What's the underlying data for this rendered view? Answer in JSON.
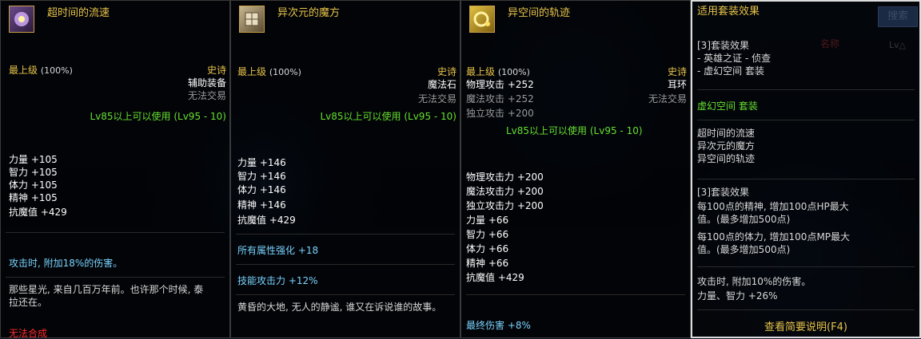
{
  "items": [
    {
      "name": "超时间的流速",
      "grade": "最上级",
      "grade_pct": "(100%)",
      "rarity": "史诗",
      "type": "辅助装备",
      "trade": "无法交易",
      "level_req": "Lv85以上可以使用 (Lv95 - 10)",
      "stats": [
        "力量 +105",
        "智力 +105",
        "体力 +105",
        "精神 +105",
        "抗魔值 +429"
      ],
      "special": "攻击时, 附加18%的伤害。",
      "flavor": "那些星光, 来自几百万年前。也许那个时候, 泰拉还在。",
      "footer": "无法合成"
    },
    {
      "name": "异次元的魔方",
      "grade": "最上级",
      "grade_pct": "(100%)",
      "rarity": "史诗",
      "type": "魔法石",
      "trade": "无法交易",
      "level_req": "Lv85以上可以使用 (Lv95 - 10)",
      "stats": [
        "力量 +146",
        "智力 +146",
        "体力 +146",
        "精神 +146",
        "抗魔值 +429"
      ],
      "bonus1": "所有属性强化 +18",
      "bonus2": "技能攻击力 +12%",
      "flavor": "黄昏的大地, 无人的静谧, 谁又在诉说谁的故事。"
    },
    {
      "name": "异空间的轨迹",
      "grade": "最上级",
      "grade_pct": "(100%)",
      "rarity": "史诗",
      "type": "耳环",
      "trade": "无法交易",
      "attacks": [
        "物理攻击 +252",
        "魔法攻击 +252",
        "独立攻击 +200"
      ],
      "level_req": "Lv85以上可以使用 (Lv95 - 10)",
      "stats": [
        "物理攻击力 +200",
        "魔法攻击力 +200",
        "独立攻击力 +200",
        "力量 +66",
        "智力 +66",
        "体力 +66",
        "精神 +66",
        "抗魔值 +429"
      ],
      "bonus": "最终伤害 +8%"
    }
  ],
  "set_panel": {
    "title": "适用套装效果",
    "search_label": "搜索",
    "effect3_header": "[3]套装效果",
    "effect3_lines": [
      "- 英雄之证 - 侦查",
      "- 虚幻空间  套装"
    ],
    "set_name": "虚幻空间  套装",
    "set_items": [
      "超时间的流速",
      "异次元的魔方",
      "异空间的轨迹"
    ],
    "effect_header": "[3]套装效果",
    "effect_lines": [
      "每100点的精神, 增加100点HP最大",
      "值。(最多增加500点)",
      "每100点的体力, 增加100点MP最大",
      "值。(最多增加500点)"
    ],
    "effect2_lines": [
      "攻击时, 附加10%的伤害。",
      "力量、智力 +26%"
    ],
    "footer_button": "查看简要说明(F4)",
    "bg_hint": [
      "名称",
      "Lv△"
    ]
  }
}
